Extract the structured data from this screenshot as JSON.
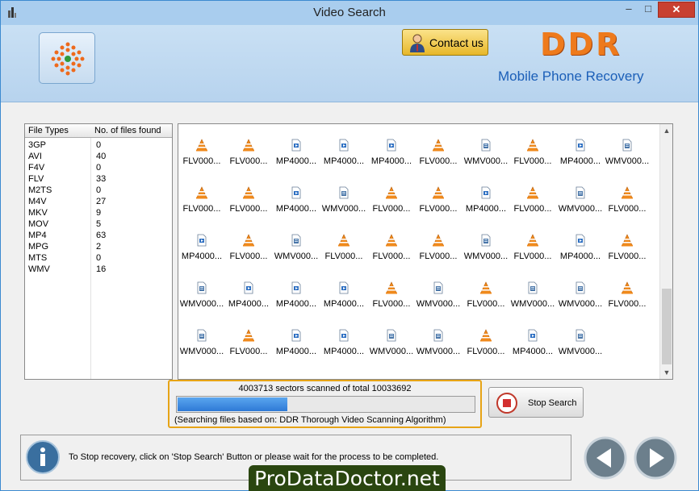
{
  "window": {
    "title": "Video Search",
    "controls": {
      "minimize": "–",
      "maximize": "□",
      "close": "✕"
    }
  },
  "header": {
    "contact_label": "Contact us",
    "brand": "DDR",
    "subtitle": "Mobile Phone Recovery"
  },
  "file_types_table": {
    "columns": [
      "File Types",
      "No. of files found"
    ],
    "rows": [
      [
        "3GP",
        "0"
      ],
      [
        "AVI",
        "40"
      ],
      [
        "F4V",
        "0"
      ],
      [
        "FLV",
        "33"
      ],
      [
        "M2TS",
        "0"
      ],
      [
        "M4V",
        "27"
      ],
      [
        "MKV",
        "9"
      ],
      [
        "MOV",
        "5"
      ],
      [
        "MP4",
        "63"
      ],
      [
        "MPG",
        "2"
      ],
      [
        "MTS",
        "0"
      ],
      [
        "WMV",
        "16"
      ]
    ]
  },
  "results_grid": {
    "partial_row_labels": [
      "FLV000...",
      "FLV000...",
      "WMV000...",
      "WMV000...",
      "FLV000...",
      "FLV000...",
      "WMV000...",
      "FLV000...",
      "FLV000...",
      "WMV000..."
    ],
    "rows": [
      [
        {
          "icon": "vlc-icon",
          "label": "FLV000..."
        },
        {
          "icon": "vlc-icon",
          "label": "FLV000..."
        },
        {
          "icon": "mp4-file-icon",
          "label": "MP4000..."
        },
        {
          "icon": "mp4-file-icon",
          "label": "MP4000..."
        },
        {
          "icon": "mp4-file-icon",
          "label": "MP4000..."
        },
        {
          "icon": "vlc-icon",
          "label": "FLV000..."
        },
        {
          "icon": "wmv-file-icon",
          "label": "WMV000..."
        },
        {
          "icon": "vlc-icon",
          "label": "FLV000..."
        },
        {
          "icon": "mp4-file-icon",
          "label": "MP4000..."
        },
        {
          "icon": "wmv-file-icon",
          "label": "WMV000..."
        }
      ],
      [
        {
          "icon": "vlc-icon",
          "label": "FLV000..."
        },
        {
          "icon": "vlc-icon",
          "label": "FLV000..."
        },
        {
          "icon": "mp4-file-icon",
          "label": "MP4000..."
        },
        {
          "icon": "wmv-file-icon",
          "label": "WMV000..."
        },
        {
          "icon": "vlc-icon",
          "label": "FLV000..."
        },
        {
          "icon": "vlc-icon",
          "label": "FLV000..."
        },
        {
          "icon": "mp4-file-icon",
          "label": "MP4000..."
        },
        {
          "icon": "vlc-icon",
          "label": "FLV000..."
        },
        {
          "icon": "wmv-file-icon",
          "label": "WMV000..."
        },
        {
          "icon": "vlc-icon",
          "label": "FLV000..."
        }
      ],
      [
        {
          "icon": "mp4-file-icon",
          "label": "MP4000..."
        },
        {
          "icon": "vlc-icon",
          "label": "FLV000..."
        },
        {
          "icon": "wmv-file-icon",
          "label": "WMV000..."
        },
        {
          "icon": "vlc-icon",
          "label": "FLV000..."
        },
        {
          "icon": "vlc-icon",
          "label": "FLV000..."
        },
        {
          "icon": "vlc-icon",
          "label": "FLV000..."
        },
        {
          "icon": "wmv-file-icon",
          "label": "WMV000..."
        },
        {
          "icon": "vlc-icon",
          "label": "FLV000..."
        },
        {
          "icon": "mp4-file-icon",
          "label": "MP4000..."
        },
        {
          "icon": "vlc-icon",
          "label": "FLV000..."
        }
      ],
      [
        {
          "icon": "wmv-file-icon",
          "label": "WMV000..."
        },
        {
          "icon": "mp4-file-icon",
          "label": "MP4000..."
        },
        {
          "icon": "mp4-file-icon",
          "label": "MP4000..."
        },
        {
          "icon": "mp4-file-icon",
          "label": "MP4000..."
        },
        {
          "icon": "vlc-icon",
          "label": "FLV000..."
        },
        {
          "icon": "wmv-file-icon",
          "label": "WMV000..."
        },
        {
          "icon": "vlc-icon",
          "label": "FLV000..."
        },
        {
          "icon": "wmv-file-icon",
          "label": "WMV000..."
        },
        {
          "icon": "wmv-file-icon",
          "label": "WMV000..."
        },
        {
          "icon": "vlc-icon",
          "label": "FLV000..."
        }
      ],
      [
        {
          "icon": "wmv-file-icon",
          "label": "WMV000..."
        },
        {
          "icon": "vlc-icon",
          "label": "FLV000..."
        },
        {
          "icon": "mp4-file-icon",
          "label": "MP4000..."
        },
        {
          "icon": "mp4-file-icon",
          "label": "MP4000..."
        },
        {
          "icon": "wmv-file-icon",
          "label": "WMV000..."
        },
        {
          "icon": "wmv-file-icon",
          "label": "WMV000..."
        },
        {
          "icon": "vlc-icon",
          "label": "FLV000..."
        },
        {
          "icon": "mp4-file-icon",
          "label": "MP4000..."
        },
        {
          "icon": "wmv-file-icon",
          "label": "WMV000..."
        }
      ]
    ]
  },
  "progress": {
    "status": "4003713 sectors scanned of total 10033692",
    "fraction": 0.3695,
    "algorithm_text": "(Searching files based on:  DDR Thorough Video Scanning Algorithm)"
  },
  "stop_button_label": "Stop Search",
  "info_message": "To Stop recovery, click on 'Stop Search' Button or please wait for the process to be completed.",
  "watermark": "ProDataDoctor.net",
  "colors": {
    "accent_orange": "#ee7a1c",
    "subtitle_blue": "#1b5fb8",
    "progress_border": "#e7a416",
    "progress_fill": "#2e79d6"
  }
}
